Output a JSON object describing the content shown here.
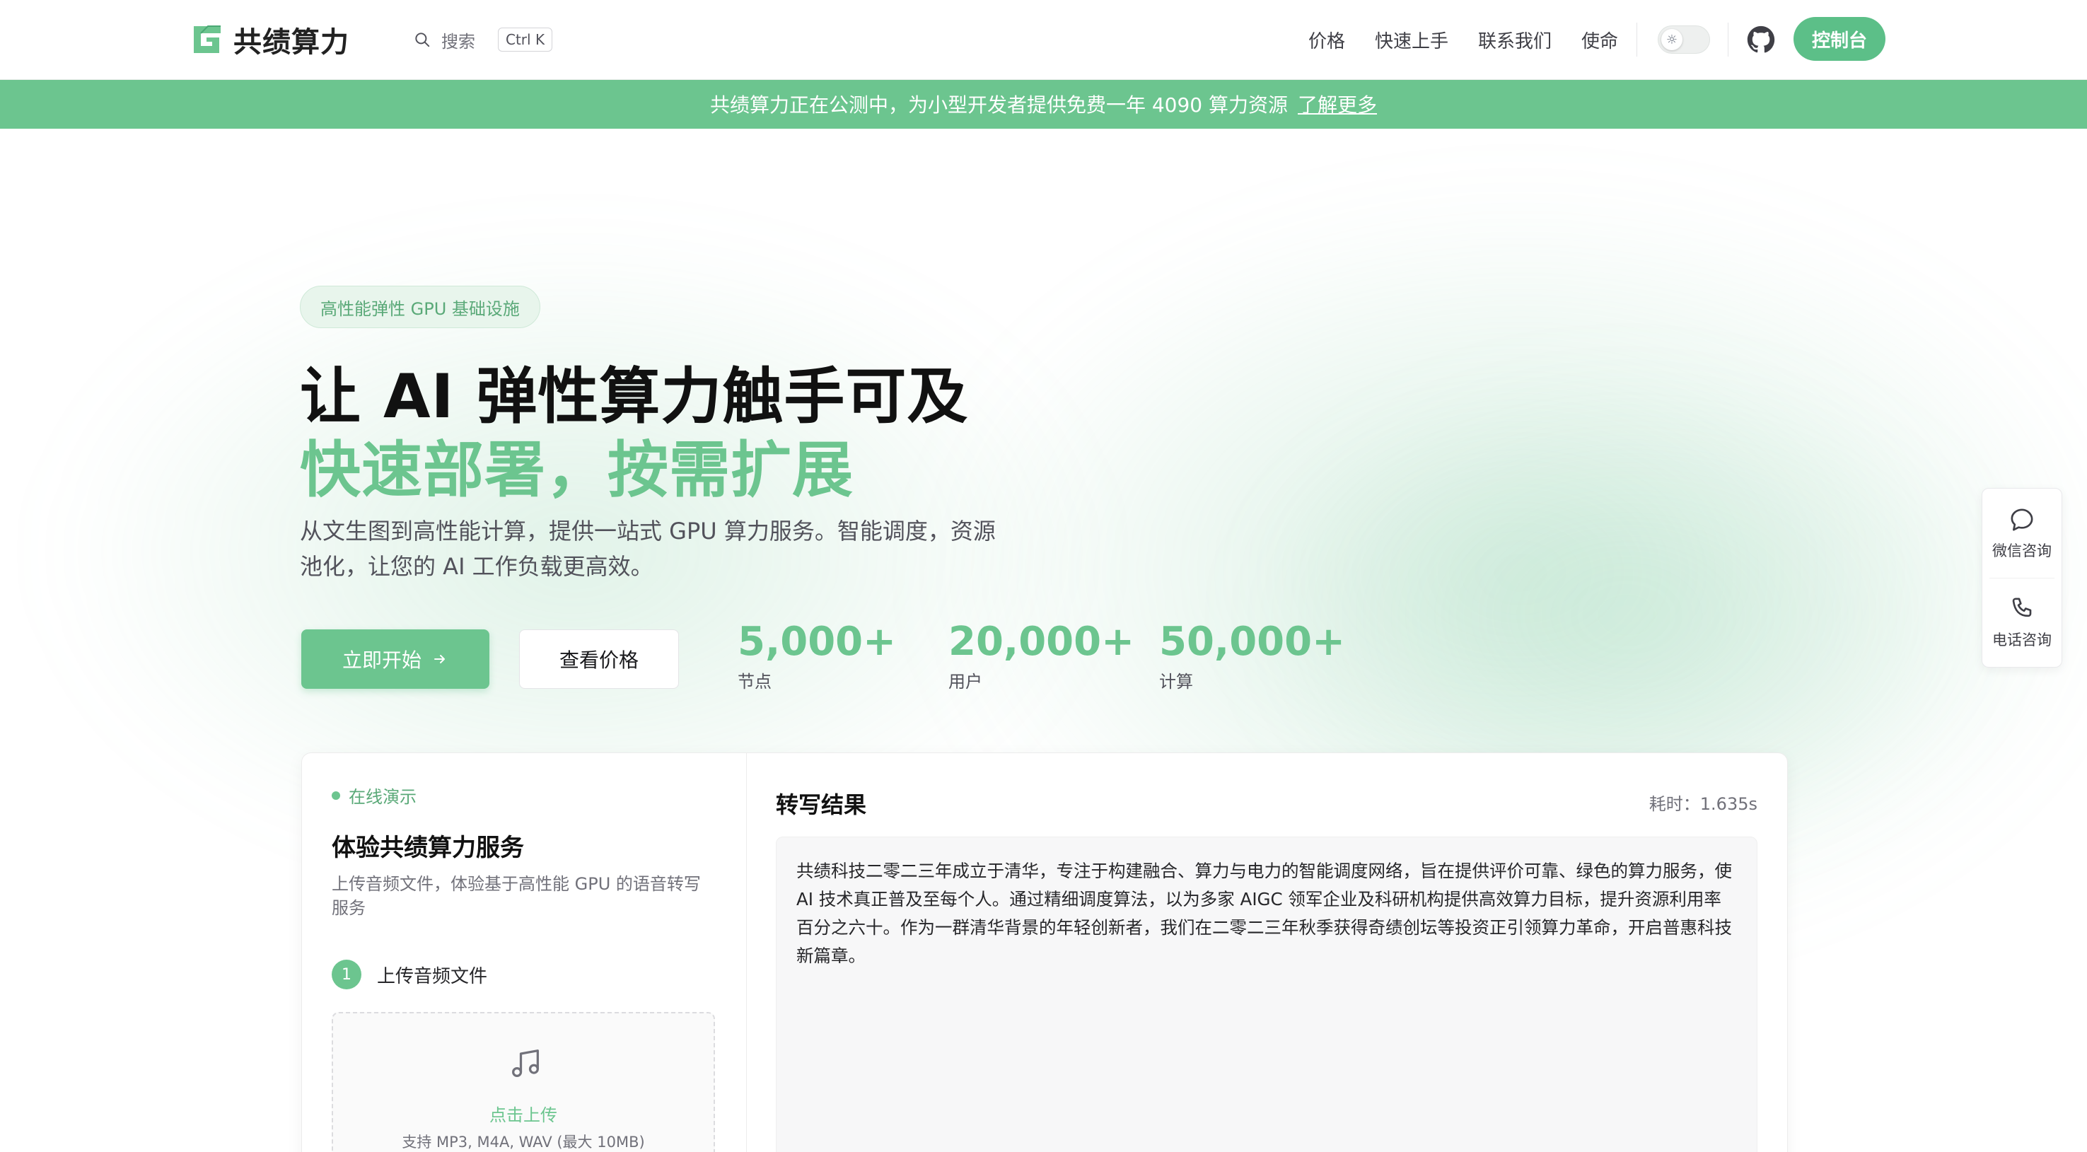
{
  "app": {
    "brand_name": "共绩算力",
    "brand_color": "#6cc58f"
  },
  "header": {
    "search": {
      "label": "搜索",
      "shortcut": "Ctrl K"
    },
    "nav": [
      {
        "label": "价格"
      },
      {
        "label": "快速上手"
      },
      {
        "label": "联系我们"
      },
      {
        "label": "使命"
      }
    ],
    "theme_toggle_icon": "sun-icon",
    "github_icon": "github-icon",
    "console_button": "控制台"
  },
  "banner": {
    "text": "共绩算力正在公测中，为小型开发者提供免费一年 4090 算力资源",
    "link": "了解更多"
  },
  "hero": {
    "badge": "高性能弹性 GPU 基础设施",
    "title_line1": "让 AI 弹性算力触手可及",
    "title_line2": "快速部署，按需扩展",
    "description": "从文生图到高性能计算，提供一站式 GPU 算力服务。智能调度，资源池化，让您的 AI 工作负载更高效。",
    "primary_button": "立即开始",
    "primary_button_icon": "arrow-right-icon",
    "secondary_button": "查看价格",
    "stats": [
      {
        "value": "5,000+",
        "label": "节点"
      },
      {
        "value": "20,000+",
        "label": "用户"
      },
      {
        "value": "50,000+",
        "label": "计算"
      }
    ]
  },
  "side_float": {
    "items": [
      {
        "label": "微信咨询",
        "icon": "chat-bubble-icon"
      },
      {
        "label": "电话咨询",
        "icon": "phone-icon"
      }
    ]
  },
  "demo": {
    "live_label": "在线演示",
    "title": "体验共绩算力服务",
    "description": "上传音频文件，体验基于高性能 GPU 的语音转写服务",
    "step": {
      "number": "1",
      "label": "上传音频文件"
    },
    "upload": {
      "icon": "music-note-icon",
      "cta": "点击上传",
      "hint": "支持 MP3, M4A, WAV (最大 10MB)"
    },
    "result": {
      "title": "转写结果",
      "elapsed": "耗时：1.635s",
      "text": "共绩科技二零二三年成立于清华，专注于构建融合、算力与电力的智能调度网络，旨在提供评价可靠、绿色的算力服务，使 AI 技术真正普及至每个人。通过精细调度算法，以为多家 AIGC 领军企业及科研机构提供高效算力目标，提升资源利用率百分之六十。作为一群清华背景的年轻创新者，我们在二零二三年秋季获得奇绩创坛等投资正引领算力革命，开启普惠科技新篇章。"
    }
  }
}
